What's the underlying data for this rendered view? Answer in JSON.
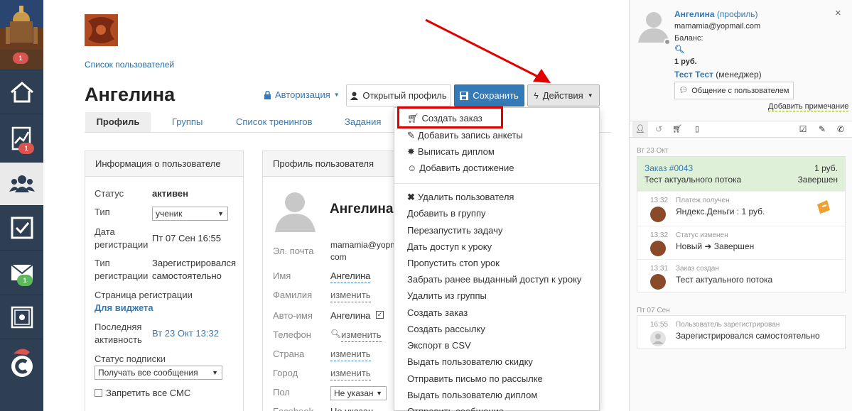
{
  "sidebar": {
    "badges": {
      "top": "1",
      "analytics": "1",
      "messages": "1"
    }
  },
  "breadcrumb": "Список пользователей",
  "page_title": "Ангелина",
  "toolbar": {
    "auth_label": "Авторизация",
    "open_profile_label": "Открытый профиль",
    "save_label": "Сохранить",
    "actions_label": "Действия"
  },
  "tabs": [
    "Профиль",
    "Группы",
    "Список тренингов",
    "Задания"
  ],
  "user_info": {
    "title": "Информация о пользователе",
    "status_label": "Статус",
    "status_value": "активен",
    "type_label": "Тип",
    "type_value": "ученик",
    "reg_date_label_1": "Дата",
    "reg_date_label_2": "регистрации",
    "reg_date_value": "Пт 07 Сен 16:55",
    "reg_type_label_1": "Тип",
    "reg_type_label_2": "регистрации",
    "reg_type_value_1": "Зарегистрировался",
    "reg_type_value_2": "самостоятельно",
    "reg_page_label": "Страница регистрации",
    "reg_page_value": "Для виджета",
    "last_active_label_1": "Последняя",
    "last_active_label_2": "активность",
    "last_active_value": "Вт 23 Окт 13:32",
    "subscription_label": "Статус подписки",
    "subscription_value": "Получать все сообщения",
    "sms_label": "Запретить все СМС"
  },
  "profile": {
    "title": "Профиль пользователя",
    "name_heading": "Ангелина",
    "email_label": "Эл. почта",
    "email_value_1": "mamamia@yopm",
    "email_value_2": "com",
    "name_label": "Имя",
    "name_value": "Ангелина",
    "surname_label": "Фамилия",
    "surname_value": "изменить",
    "autoname_label": "Авто-имя",
    "autoname_value": "Ангелина",
    "phone_label": "Телефон",
    "phone_value": "изменить",
    "country_label": "Страна",
    "country_value": "изменить",
    "city_label": "Город",
    "city_value": "изменить",
    "gender_label": "Пол",
    "gender_value": "Не указан",
    "facebook_label": "Facebook",
    "facebook_value": "Не указан"
  },
  "actions_menu": {
    "group1": [
      "Создать заказ",
      "Добавить запись анкеты",
      "Выписать диплом",
      "Добавить достижение"
    ],
    "group2": [
      "Удалить пользователя",
      "Добавить в группу",
      "Перезапустить задачу",
      "Дать доступ к уроку",
      "Пропустить стоп урок",
      "Забрать ранее выданный доступ к уроку",
      "Удалить из группы",
      "Создать заказ",
      "Создать рассылку",
      "Экспорт в CSV",
      "Выдать пользователю скидку",
      "Отправить письмо по рассылке",
      "Выдать пользователю диплом",
      "Отправить сообщение"
    ]
  },
  "right_panel": {
    "user_name": "Ангелина",
    "profile_link": "(профиль)",
    "email": "mamamia@yopmail.com",
    "balance_label": "Баланс:",
    "balance_value": "1 руб.",
    "manager_name": "Тест Тест",
    "manager_role": "(менеджер)",
    "chat_button": "Общение с пользователем",
    "add_note": "Добавить примечание",
    "date1": "Вт 23 Окт",
    "order_title": "Заказ #0043",
    "order_amount": "1 руб.",
    "order_stream": "Тест актуального потока",
    "order_status": "Завершен",
    "events": [
      {
        "time": "13:32",
        "label": "Платеж получен",
        "text": "Яндекс.Деньги : 1 руб."
      },
      {
        "time": "13:32",
        "label": "Статус изменен",
        "text": "Новый ➜ Завершен"
      },
      {
        "time": "13:31",
        "label": "Заказ создан",
        "text": "Тест актуального потока"
      }
    ],
    "date2": "Пт 07 Сен",
    "reg_event": {
      "time": "16:55",
      "label": "Пользователь зарегистрирован",
      "text": "Зарегистрировался самостоятельно"
    }
  },
  "colors": {
    "rail": "#2e3f53",
    "primary": "#337ab7",
    "badge_red": "#d9534f",
    "badge_green": "#5cb85c",
    "order_bg": "#dff0d8",
    "highlight": "#e00000"
  }
}
